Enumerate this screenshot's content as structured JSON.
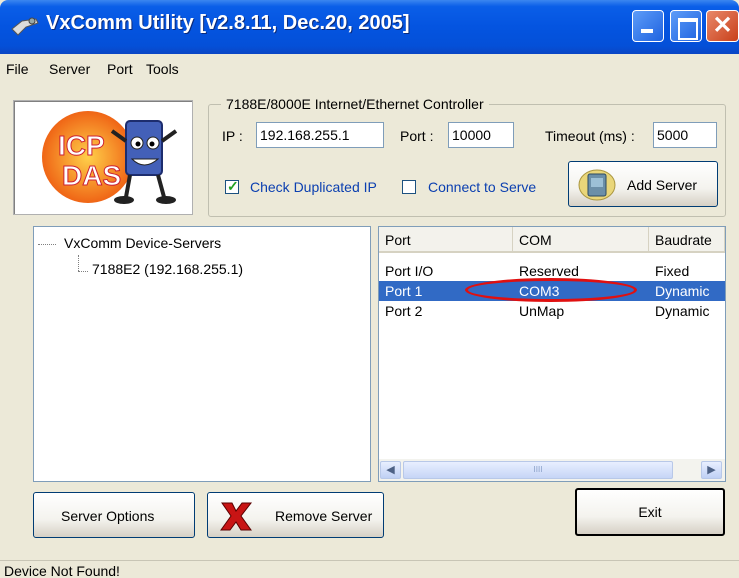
{
  "window": {
    "title": "VxComm Utility [v2.8.11, Dec.20, 2005]",
    "title_bar_color": "#0454e0",
    "close_button_color": "#c9401a"
  },
  "menu": [
    "File",
    "Server",
    "Port",
    "Tools"
  ],
  "logo": {
    "text_line1": "ICP",
    "text_line2": "DAS"
  },
  "controller_group": {
    "caption": "7188E/8000E Internet/Ethernet Controller",
    "ip_label": "IP :",
    "ip_value": "192.168.255.1",
    "port_label": "Port :",
    "port_value": "10000",
    "timeout_label": "Timeout (ms) :",
    "timeout_value": "5000",
    "check_duplicated_ip_label": "Check Duplicated IP",
    "check_duplicated_ip_checked": true,
    "connect_to_server_label": "Connect to Serve",
    "connect_to_server_checked": false,
    "add_server_label": "Add Server"
  },
  "tree": {
    "root": "VxComm Device-Servers",
    "child": "7188E2 (192.168.255.1)"
  },
  "ports_list": {
    "columns": [
      "Port",
      "COM",
      "Baudrate"
    ],
    "rows": [
      {
        "port": "Port I/O",
        "com": "Reserved",
        "baudrate": "Fixed"
      },
      {
        "port": "Port 1",
        "com": "COM3",
        "baudrate": "Dynamic"
      },
      {
        "port": "Port 2",
        "com": "UnMap",
        "baudrate": "Dynamic"
      }
    ],
    "selected_row": 1,
    "selection_color": "#316ac5",
    "annotation_color": "#e01010",
    "scroll_thumb_glyph": "IIII"
  },
  "buttons": {
    "server_options": "Server Options",
    "remove_server": "Remove Server",
    "exit": "Exit"
  },
  "status_bar": {
    "text": "Device Not Found!"
  }
}
